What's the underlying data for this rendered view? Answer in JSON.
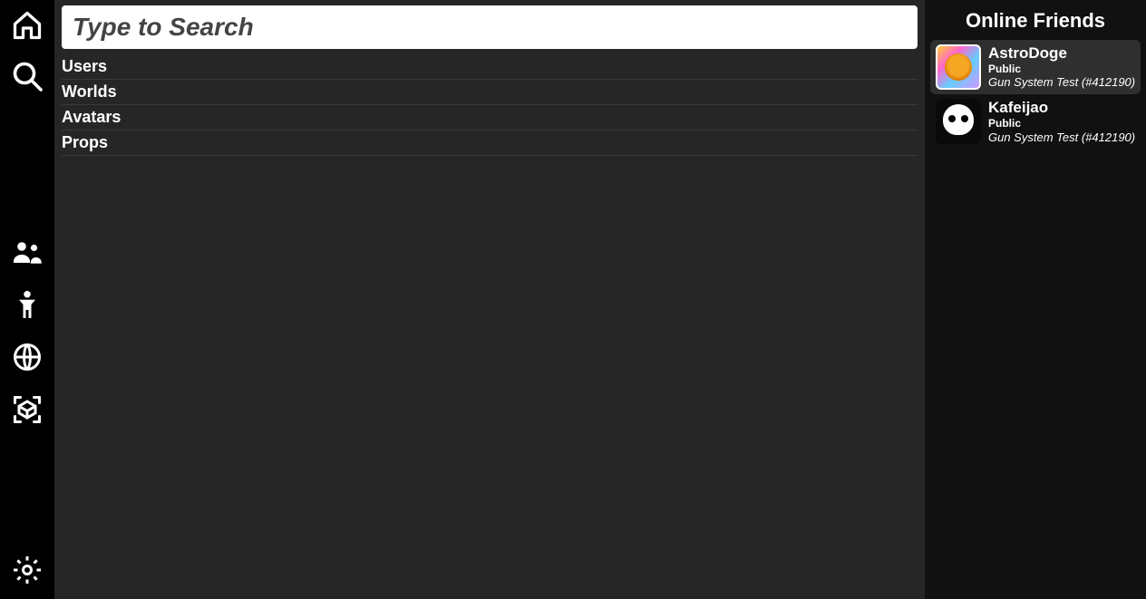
{
  "search": {
    "placeholder": "Type to Search",
    "value": ""
  },
  "categories": [
    {
      "label": "Users"
    },
    {
      "label": "Worlds"
    },
    {
      "label": "Avatars"
    },
    {
      "label": "Props"
    }
  ],
  "friends_panel": {
    "title": "Online Friends",
    "friends": [
      {
        "name": "AstroDoge",
        "visibility": "Public",
        "world": "Gun System Test (#412190)",
        "selected": true
      },
      {
        "name": "Kafeijao",
        "visibility": "Public",
        "world": "Gun System Test (#412190)",
        "selected": false
      }
    ]
  }
}
